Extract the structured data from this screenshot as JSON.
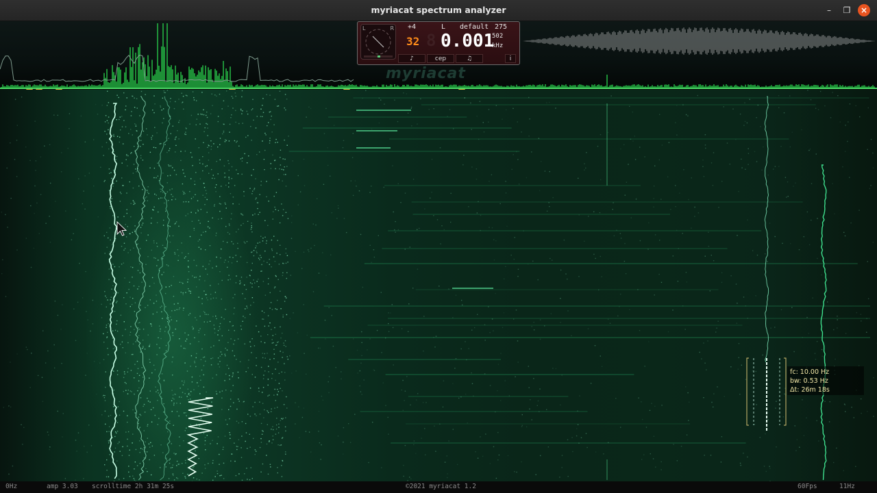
{
  "window": {
    "title": "myriacat spectrum analyzer",
    "minimize_glyph": "–",
    "maximize_glyph": "❐",
    "close_glyph": "×"
  },
  "panel": {
    "scope_left": "L",
    "scope_right": "R",
    "plus": "+4",
    "channel": "L",
    "preset": "default",
    "number": "275",
    "counter": "32",
    "counter_ghost": "8",
    "frequency": "0.001",
    "sample_value": "502",
    "unit": "kHz",
    "buttons": {
      "note1": "♪",
      "cep": "cep",
      "note2": "♫",
      "info": "i"
    }
  },
  "watermark": "myriacat",
  "selection": {
    "fc": "fc: 10.00 Hz",
    "bw": "bw: 0.53 Hz",
    "dt": "Δt: 26m 18s"
  },
  "status": {
    "left_freq": "0Hz",
    "amp": "amp 3.03",
    "scrolltime": "scrolltime 2h 31m 25s",
    "copyright": "©2021 myriacat 1.2",
    "fps": "60Fps",
    "right_freq": "11Hz"
  },
  "colors": {
    "accent": "#39ff6a",
    "marker": "#d9b23a",
    "close_button": "#e95420",
    "panel_bg": "#3a1418",
    "counter_orange": "#ff8c1a"
  },
  "icons": {
    "cursor": "mouse-pointer-icon",
    "markers": "triangle-marker-icon"
  }
}
